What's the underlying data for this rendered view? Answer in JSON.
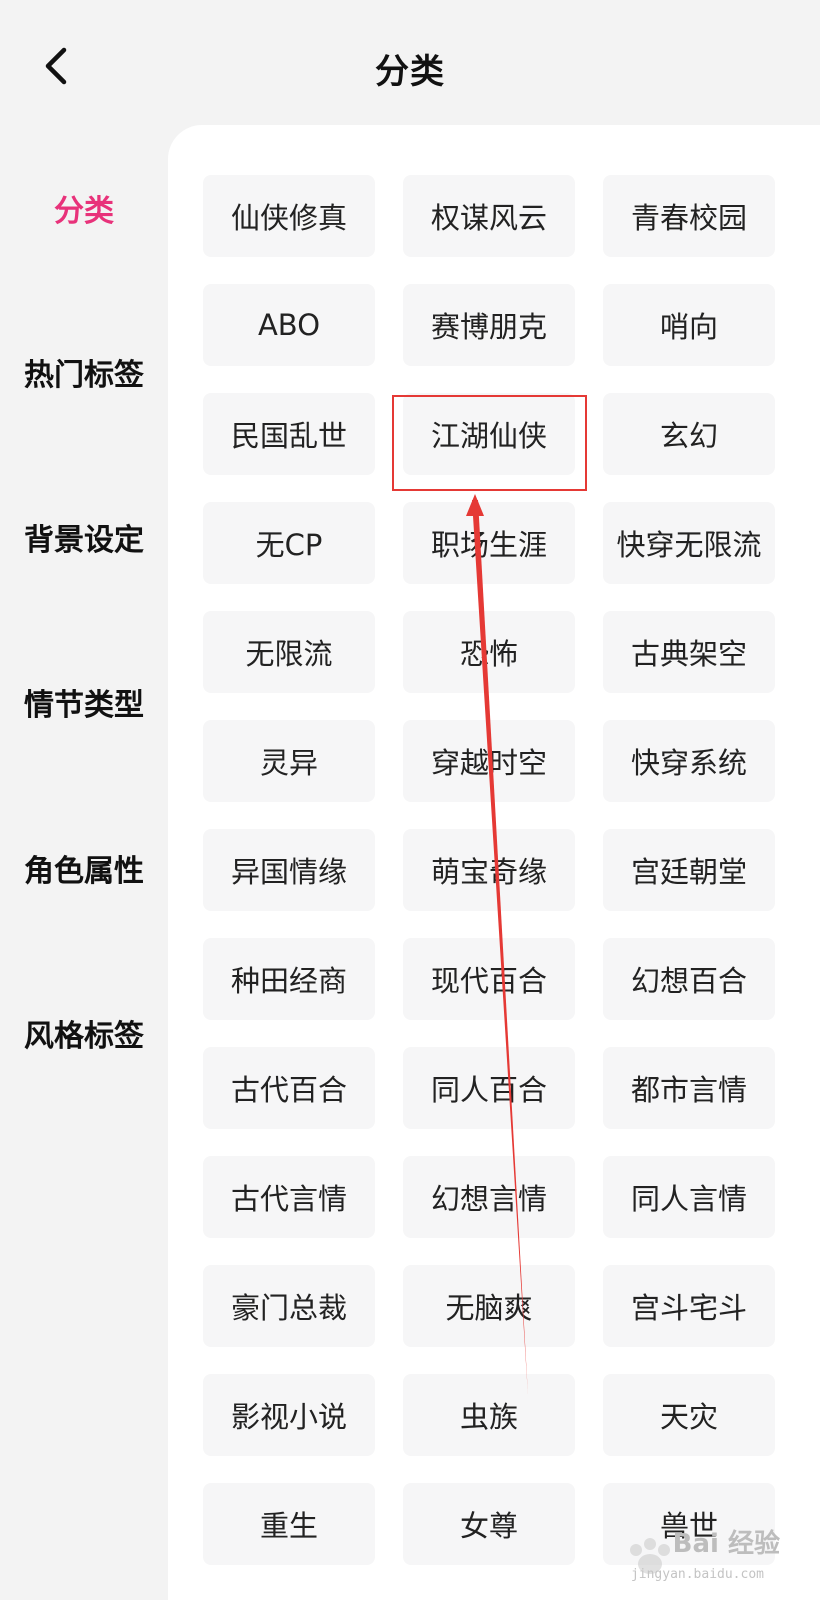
{
  "header": {
    "title": "分类",
    "back_icon": "chevron-left-icon"
  },
  "sidebar": {
    "items": [
      {
        "label": "分类",
        "active": true
      },
      {
        "label": "热门标签",
        "active": false
      },
      {
        "label": "背景设定",
        "active": false
      },
      {
        "label": "情节类型",
        "active": false
      },
      {
        "label": "角色属性",
        "active": false
      },
      {
        "label": "风格标签",
        "active": false
      }
    ]
  },
  "tags": [
    "仙侠修真",
    "权谋风云",
    "青春校园",
    "ABO",
    "赛博朋克",
    "哨向",
    "民国乱世",
    "江湖仙侠",
    "玄幻",
    "无CP",
    "职场生涯",
    "快穿无限流",
    "无限流",
    "恐怖",
    "古典架空",
    "灵异",
    "穿越时空",
    "快穿系统",
    "异国情缘",
    "萌宝奇缘",
    "宫廷朝堂",
    "种田经商",
    "现代百合",
    "幻想百合",
    "古代百合",
    "同人百合",
    "都市言情",
    "古代言情",
    "幻想言情",
    "同人言情",
    "豪门总裁",
    "无脑爽",
    "宫斗宅斗",
    "影视小说",
    "虫族",
    "天灾",
    "重生",
    "女尊",
    "兽世"
  ],
  "annotation": {
    "highlighted_tag": "江湖仙侠",
    "color": "#e53935"
  },
  "watermark": {
    "text": "Bai 经验",
    "sub": "jingyan.baidu.com"
  },
  "colors": {
    "accent": "#e8327a",
    "background": "#f3f3f3",
    "tag_background": "#f6f6f7"
  }
}
